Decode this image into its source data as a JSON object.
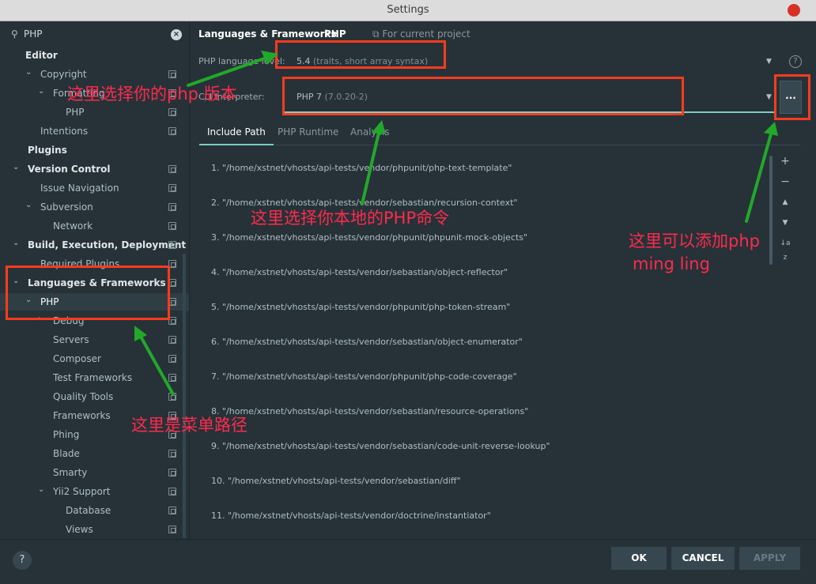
{
  "window": {
    "title": "Settings"
  },
  "search": {
    "value": "PHP",
    "icon": "search-icon",
    "clear_icon": "clear-icon"
  },
  "sidebar": {
    "items": [
      {
        "label": "Editor",
        "bold": true,
        "arrow": ""
      },
      {
        "label": "Copyright",
        "bold": false,
        "arrow": "down"
      },
      {
        "label": "Formatting",
        "bold": false,
        "arrow": "down"
      },
      {
        "label": "PHP",
        "bold": false,
        "arrow": ""
      },
      {
        "label": "Intentions",
        "bold": false,
        "arrow": ""
      },
      {
        "label": "Plugins",
        "bold": true,
        "arrow": ""
      },
      {
        "label": "Version Control",
        "bold": true,
        "arrow": "down"
      },
      {
        "label": "Issue Navigation",
        "bold": false,
        "arrow": ""
      },
      {
        "label": "Subversion",
        "bold": false,
        "arrow": "down"
      },
      {
        "label": "Network",
        "bold": false,
        "arrow": ""
      },
      {
        "label": "Build, Execution, Deployment",
        "bold": true,
        "arrow": "down"
      },
      {
        "label": "Required Plugins",
        "bold": false,
        "arrow": ""
      },
      {
        "label": "Languages & Frameworks",
        "bold": true,
        "arrow": "down"
      },
      {
        "label": "PHP",
        "bold": false,
        "arrow": "down",
        "selected": true
      },
      {
        "label": "Debug",
        "bold": false,
        "arrow": "right"
      },
      {
        "label": "Servers",
        "bold": false,
        "arrow": ""
      },
      {
        "label": "Composer",
        "bold": false,
        "arrow": ""
      },
      {
        "label": "Test Frameworks",
        "bold": false,
        "arrow": ""
      },
      {
        "label": "Quality Tools",
        "bold": false,
        "arrow": ""
      },
      {
        "label": "Frameworks",
        "bold": false,
        "arrow": ""
      },
      {
        "label": "Phing",
        "bold": false,
        "arrow": ""
      },
      {
        "label": "Blade",
        "bold": false,
        "arrow": ""
      },
      {
        "label": "Smarty",
        "bold": false,
        "arrow": ""
      },
      {
        "label": "Yii2 Support",
        "bold": false,
        "arrow": "down"
      },
      {
        "label": "Database",
        "bold": false,
        "arrow": ""
      },
      {
        "label": "Views",
        "bold": false,
        "arrow": ""
      }
    ]
  },
  "breadcrumb": {
    "section": "Languages & Frameworks",
    "separator": "›",
    "page": "PHP",
    "note": "For current project"
  },
  "language_level": {
    "label": "PHP language level:",
    "version": "5.4",
    "detail": "(traits, short array syntax)"
  },
  "interpreter": {
    "label": "CLI Interpreter:",
    "name": "PHP 7",
    "detail": "(7.0.20-2)",
    "more_button": "..."
  },
  "help_icon": "?",
  "tabs": [
    {
      "label": "Include Path",
      "active": true
    },
    {
      "label": "PHP Runtime",
      "active": false
    },
    {
      "label": "Analysis",
      "active": false
    }
  ],
  "include_paths": [
    "1. \"/home/xstnet/vhosts/api-tests/vendor/phpunit/php-text-template\"",
    "2. \"/home/xstnet/vhosts/api-tests/vendor/sebastian/recursion-context\"",
    "3. \"/home/xstnet/vhosts/api-tests/vendor/phpunit/phpunit-mock-objects\"",
    "4. \"/home/xstnet/vhosts/api-tests/vendor/sebastian/object-reflector\"",
    "5. \"/home/xstnet/vhosts/api-tests/vendor/phpunit/php-token-stream\"",
    "6. \"/home/xstnet/vhosts/api-tests/vendor/sebastian/object-enumerator\"",
    "7. \"/home/xstnet/vhosts/api-tests/vendor/phpunit/php-code-coverage\"",
    "8. \"/home/xstnet/vhosts/api-tests/vendor/sebastian/resource-operations\"",
    "9. \"/home/xstnet/vhosts/api-tests/vendor/sebastian/code-unit-reverse-lookup\"",
    "10. \"/home/xstnet/vhosts/api-tests/vendor/sebastian/diff\"",
    "11. \"/home/xstnet/vhosts/api-tests/vendor/doctrine/instantiator\""
  ],
  "list_tools": {
    "add": "+",
    "remove": "−",
    "up": "▲",
    "down": "▼",
    "sort": "↓a z"
  },
  "buttons": {
    "ok": "OK",
    "cancel": "CANCEL",
    "apply": "APPLY",
    "help": "?"
  },
  "annotations": {
    "choose_version": "这里选择你的php 版本",
    "choose_command": "这里选择你本地的PHP命令",
    "add_php_line1": "这里可以添加php",
    "add_php_line2": "ming ling",
    "menu_path": "这里是菜单路径",
    "color": "#ff2a4d",
    "box_color": "#ff3b1f",
    "arrow_color": "#22a82a"
  },
  "colors": {
    "background": "#263238",
    "accent": "#80cbc4",
    "titlebar": "#dcdcdc",
    "close": "#d93025"
  }
}
